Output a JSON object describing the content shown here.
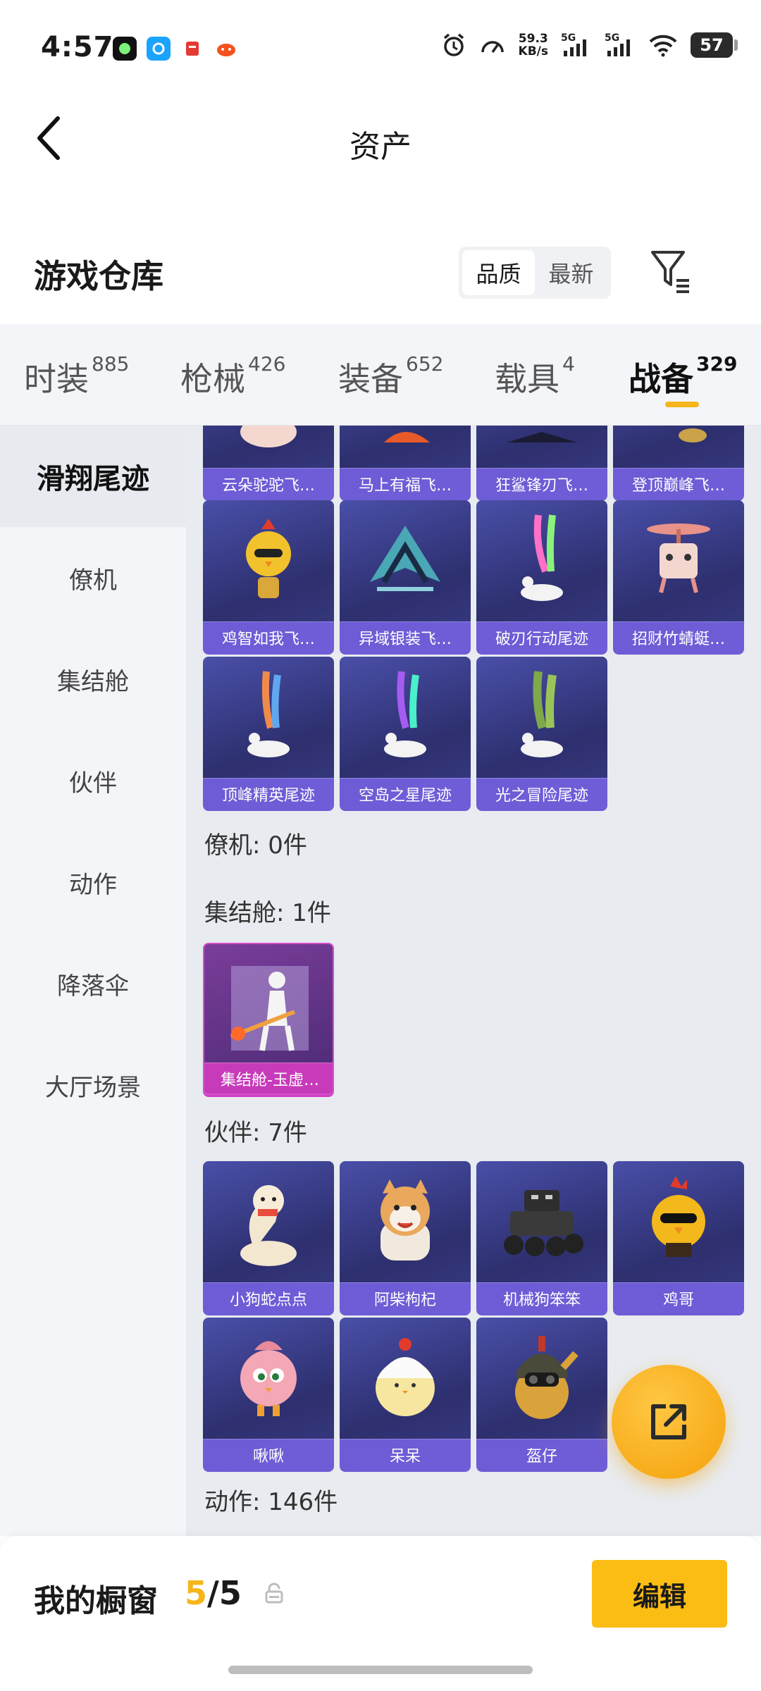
{
  "status_bar": {
    "time": "4:57",
    "net_speed": "59.3",
    "net_unit": "KB/s",
    "signal_1": "5G",
    "signal_2": "5G",
    "battery": "57",
    "icons": [
      "app-notif-icon",
      "browser-notif-icon",
      "news-notif-icon",
      "game-notif-icon",
      "alarm-icon",
      "speed-icon",
      "signal-icon",
      "wifi-icon",
      "battery-icon"
    ]
  },
  "header": {
    "title": "资产",
    "back_icon": "back-chevron-icon"
  },
  "warehouse": {
    "title": "游戏仓库",
    "sort_options": [
      "品质",
      "最新"
    ],
    "active_sort": "品质",
    "filter_icon": "filter-icon"
  },
  "tabs": [
    {
      "label": "时装",
      "count": "885"
    },
    {
      "label": "枪械",
      "count": "426"
    },
    {
      "label": "装备",
      "count": "652"
    },
    {
      "label": "载具",
      "count": "4"
    },
    {
      "label": "战备",
      "count": "329"
    }
  ],
  "active_tab": "战备",
  "sidebar": [
    "滑翔尾迹",
    "僚机",
    "集结舱",
    "伙伴",
    "动作",
    "降落伞",
    "大厅场景"
  ],
  "active_sidebar": "滑翔尾迹",
  "content": {
    "glide_row_top": [
      "云朵驼驼飞…",
      "马上有福飞…",
      "狂鲨锋刃飞…",
      "登顶巅峰飞…"
    ],
    "glide_row_2": [
      "鸡智如我飞…",
      "异域银装飞…",
      "破刃行动尾迹",
      "招财竹蜻蜓…"
    ],
    "glide_row_3": [
      "顶峰精英尾迹",
      "空岛之星尾迹",
      "光之冒险尾迹"
    ],
    "wingman_heading": "僚机: 0件",
    "capsule_heading": "集结舱: 1件",
    "capsule_items": [
      "集结舱-玉虚…"
    ],
    "partner_heading": "伙伴: 7件",
    "partner_row_1": [
      "小狗蛇点点",
      "阿柴枸杞",
      "机械狗笨笨",
      "鸡哥"
    ],
    "partner_row_2": [
      "啾啾",
      "呆呆",
      "盔仔"
    ],
    "emote_heading": "动作: 146件"
  },
  "fab_icon": "share-icon",
  "bottom": {
    "label": "我的橱窗",
    "count_used": "5",
    "count_sep": "/",
    "count_total": "5",
    "lock_icon": "lock-icon",
    "edit_label": "编辑"
  },
  "colors": {
    "accent": "#f5b51b",
    "card_bg": "#3a3c86",
    "card_label": "#7864e6",
    "rare_card": "#cd3cbe"
  }
}
